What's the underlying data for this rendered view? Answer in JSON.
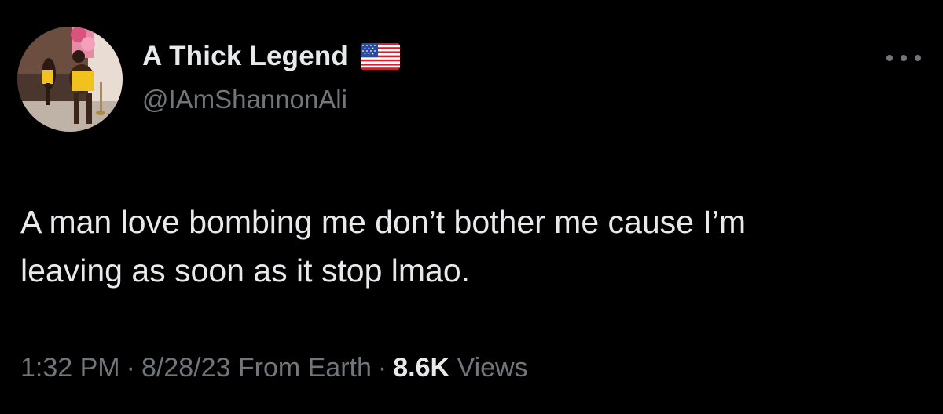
{
  "user": {
    "display_name": "A Thick Legend",
    "handle": "@IAmShannonAli",
    "flag_icon": "us-flag-icon",
    "avatar_icon": "profile-photo"
  },
  "tweet": {
    "text": "A man love bombing me don’t bother me cause I’m\nleaving as soon as it stop lmao."
  },
  "meta": {
    "time": "1:32 PM",
    "separator": "·",
    "date": "8/28/23",
    "source": "From Earth",
    "views_count": "8.6K",
    "views_label": "Views"
  },
  "actions": {
    "more_icon": "more-options-icon"
  },
  "colors": {
    "background": "#000000",
    "primary_text": "#e7e9ea",
    "secondary_text": "#71767b"
  }
}
